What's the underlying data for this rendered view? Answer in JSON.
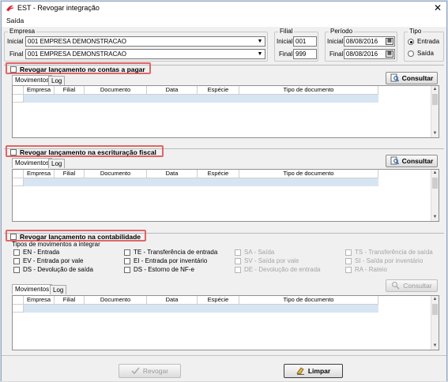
{
  "window": {
    "title": "EST - Revogar integração",
    "close": "✕"
  },
  "menu": {
    "items": [
      "Saída"
    ]
  },
  "empresa": {
    "title": "Empresa",
    "inicial_label": "Inicial",
    "final_label": "Final",
    "inicial_value": "001 EMPRESA DEMONSTRACAO",
    "final_value": "001 EMPRESA DEMONSTRACAO"
  },
  "filial": {
    "title": "Filial",
    "inicial_label": "Inicial",
    "final_label": "Final",
    "inicial_value": "001",
    "final_value": "999"
  },
  "periodo": {
    "title": "Período",
    "inicial_label": "Inicial",
    "final_label": "Final",
    "inicial_value": "08/08/2016",
    "final_value": "08/08/2016"
  },
  "tipo": {
    "title": "Tipo",
    "options": [
      "Entrada",
      "Saída"
    ],
    "selected": "Entrada"
  },
  "section1": {
    "label": "Revogar lançamento no contas a pagar",
    "tabs": [
      "Movimentos",
      "Log"
    ],
    "consultar": "Consultar"
  },
  "section2": {
    "label": "Revogar lançamento na escrituração fiscal",
    "tabs": [
      "Movimentos",
      "Log"
    ],
    "consultar": "Consultar"
  },
  "section3": {
    "label": "Revogar lançamento na contabilidade",
    "tipos_title": "Tipos de movimentos a integrar",
    "tipos": [
      [
        "EN - Entrada",
        "TE - Transferência de entrada",
        "SA - Saída",
        "TS - Transferência de saída"
      ],
      [
        "EV - Entrada por vale",
        "EI - Entrada por inventário",
        "SV - Saída por vale",
        "SI - Saída por inventário"
      ],
      [
        "DS - Devolução de saída",
        "DS - Estorno de NF-e",
        "DE - Devolução de entrada",
        "RA - Rateio"
      ]
    ],
    "tabs": [
      "Movimentos",
      "Log"
    ],
    "consultar": "Consultar"
  },
  "grid_headers": [
    "Empresa",
    "Filial",
    "Documento",
    "Data",
    "Espécie",
    "Tipo de documento"
  ],
  "footer": {
    "revogar": "Revogar",
    "limpar": "Limpar"
  }
}
